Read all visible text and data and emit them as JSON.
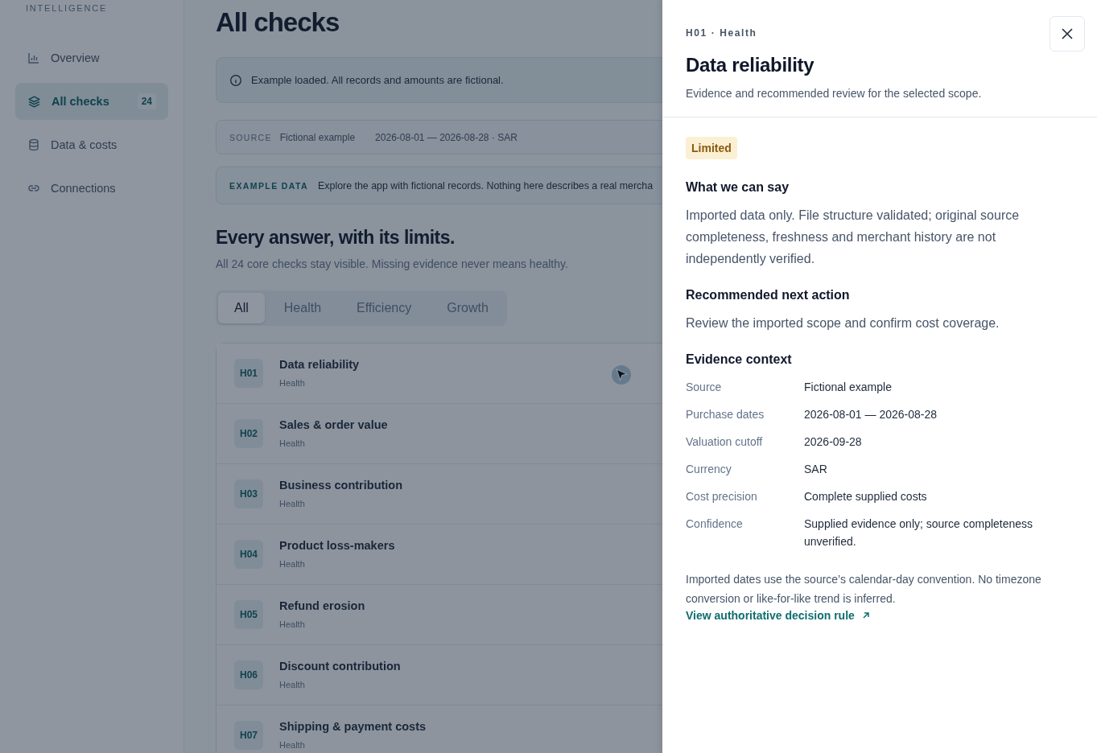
{
  "sidebar": {
    "section_label": "INTELLIGENCE",
    "items": [
      {
        "label": "Overview",
        "selected": false
      },
      {
        "label": "All checks",
        "selected": true,
        "count": "24"
      },
      {
        "label": "Data & costs",
        "selected": false
      },
      {
        "label": "Connections",
        "selected": false
      }
    ]
  },
  "main": {
    "title": "All checks",
    "notice": "Example loaded. All records and amounts are fictional.",
    "source": {
      "label": "SOURCE",
      "name": "Fictional example",
      "range": "2026-08-01 — 2026-08-28 · SAR"
    },
    "example": {
      "label": "EXAMPLE DATA",
      "text": "Explore the app with fictional records. Nothing here describes a real mercha"
    },
    "heading": "Every answer, with its limits.",
    "subheading": "All 24 core checks stay visible. Missing evidence never means healthy.",
    "filters": [
      {
        "label": "All",
        "selected": true
      },
      {
        "label": "Health",
        "selected": false
      },
      {
        "label": "Efficiency",
        "selected": false
      },
      {
        "label": "Growth",
        "selected": false
      }
    ],
    "checks": [
      {
        "code": "H01",
        "title": "Data reliability",
        "category": "Health",
        "hovered": true
      },
      {
        "code": "H02",
        "title": "Sales & order value",
        "category": "Health",
        "hovered": false
      },
      {
        "code": "H03",
        "title": "Business contribution",
        "category": "Health",
        "hovered": false
      },
      {
        "code": "H04",
        "title": "Product loss-makers",
        "category": "Health",
        "hovered": false
      },
      {
        "code": "H05",
        "title": "Refund erosion",
        "category": "Health",
        "hovered": false
      },
      {
        "code": "H06",
        "title": "Discount contribution",
        "category": "Health",
        "hovered": false
      },
      {
        "code": "H07",
        "title": "Shipping & payment costs",
        "category": "Health",
        "hovered": false
      }
    ]
  },
  "drawer": {
    "eyebrow": "H01 · Health",
    "title": "Data reliability",
    "subtitle": "Evidence and recommended review for the selected scope.",
    "status": {
      "label": "Limited",
      "kind": "limited"
    },
    "sections": [
      {
        "heading": "What we can say",
        "text": "Imported data only. File structure validated; original source completeness, freshness and merchant history are not independently verified."
      },
      {
        "heading": "Recommended next action",
        "text": "Review the imported scope and confirm cost coverage."
      }
    ],
    "evidence_heading": "Evidence context",
    "evidence": [
      {
        "label": "Source",
        "value": "Fictional example"
      },
      {
        "label": "Purchase dates",
        "value": "2026-08-01 — 2026-08-28"
      },
      {
        "label": "Valuation cutoff",
        "value": "2026-09-28"
      },
      {
        "label": "Currency",
        "value": "SAR"
      },
      {
        "label": "Cost precision",
        "value": "Complete supplied costs"
      },
      {
        "label": "Confidence",
        "value": "Supplied evidence only; source completeness unverified."
      }
    ],
    "note": "Imported dates use the source’s calendar-day convention. No timezone conversion or like-for-like trend is inferred.",
    "link": "View authoritative decision rule"
  }
}
